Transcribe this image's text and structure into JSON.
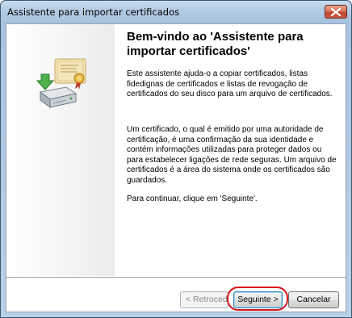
{
  "window": {
    "title": "Assistente para importar certificados"
  },
  "icons": {
    "close": "close-icon",
    "certificate": "certificate-icon"
  },
  "content": {
    "heading": "Bem-vindo ao 'Assistente para importar certificados'",
    "paragraph1": "Este assistente ajuda-o a copiar certificados, listas fidedignas de certificados e listas de revogação de certificados do seu disco para um arquivo de certificados.",
    "paragraph2": "Um certificado, o qual é emitido por uma autoridade de certificação, é uma confirmação da sua identidade e contém informações utilizadas para proteger dados ou para estabelecer ligações de rede seguras. Um arquivo de certificados é a área do sistema onde os certificados são guardados.",
    "paragraph3": "Para continuar, clique em 'Seguinte'."
  },
  "buttons": {
    "back_label": "< Retroceder",
    "next_label": "Seguinte >",
    "cancel_label": "Cancelar"
  },
  "colors": {
    "highlight": "#d8141c",
    "titlebar": "#b3cbe3",
    "close_button": "#c24a2f"
  }
}
